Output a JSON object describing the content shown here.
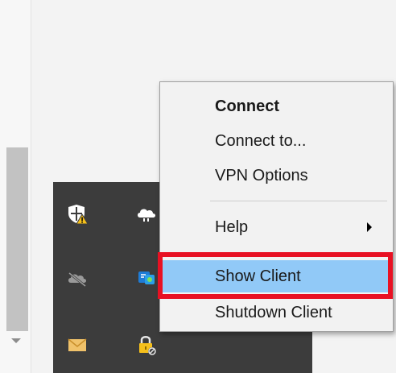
{
  "context_menu": {
    "items": [
      {
        "label": "Connect"
      },
      {
        "label": "Connect to..."
      },
      {
        "label": "VPN Options"
      },
      {
        "label": "Help"
      },
      {
        "label": "Show Client"
      },
      {
        "label": "Shutdown Client"
      }
    ]
  },
  "tray": {
    "icons": [
      "shield-warning-icon",
      "cloud-icon",
      "cloud-offline-icon",
      "network-sync-icon",
      "mail-icon",
      "vpn-lock-icon"
    ]
  },
  "colors": {
    "menu_background": "#f2f2f2",
    "highlight": "#91c9f7",
    "annotation_border": "#e81123",
    "tray_background": "#3c3c3c"
  }
}
